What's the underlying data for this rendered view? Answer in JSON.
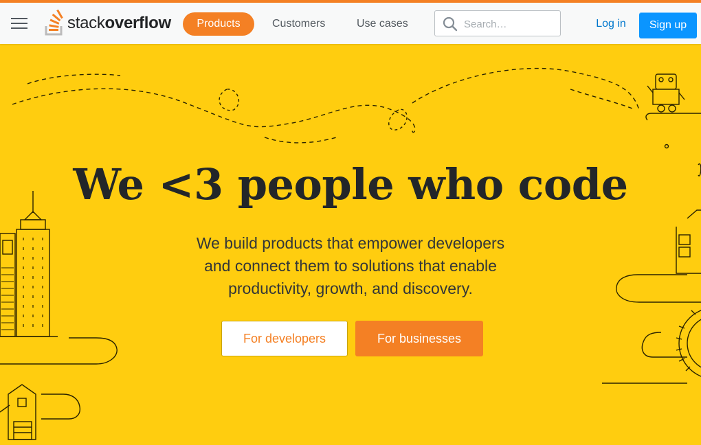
{
  "brand": {
    "logo_light": "stack",
    "logo_bold": "overflow",
    "accent_color": "#f48024",
    "hero_color": "#ffcd0f",
    "link_color": "#0077cc",
    "signup_color": "#0a95ff"
  },
  "nav": {
    "menu_icon": "hamburger-icon",
    "items": [
      {
        "label": "Products",
        "active": true
      },
      {
        "label": "Customers",
        "active": false
      },
      {
        "label": "Use cases",
        "active": false
      }
    ],
    "search": {
      "placeholder": "Search…",
      "value": "",
      "icon": "search-icon"
    },
    "login_label": "Log in",
    "signup_label": "Sign up"
  },
  "hero": {
    "headline": "We <3 people who code",
    "subtitle_lines": [
      "We build products that empower developers",
      "and connect them to solutions that enable",
      "productivity, growth, and discovery."
    ],
    "cta_developers": "For developers",
    "cta_businesses": "For businesses",
    "illustrations": [
      "robot-icon",
      "skyscraper-icon",
      "house-icon",
      "gear-icon",
      "building-icon",
      "cloud-icon"
    ]
  }
}
